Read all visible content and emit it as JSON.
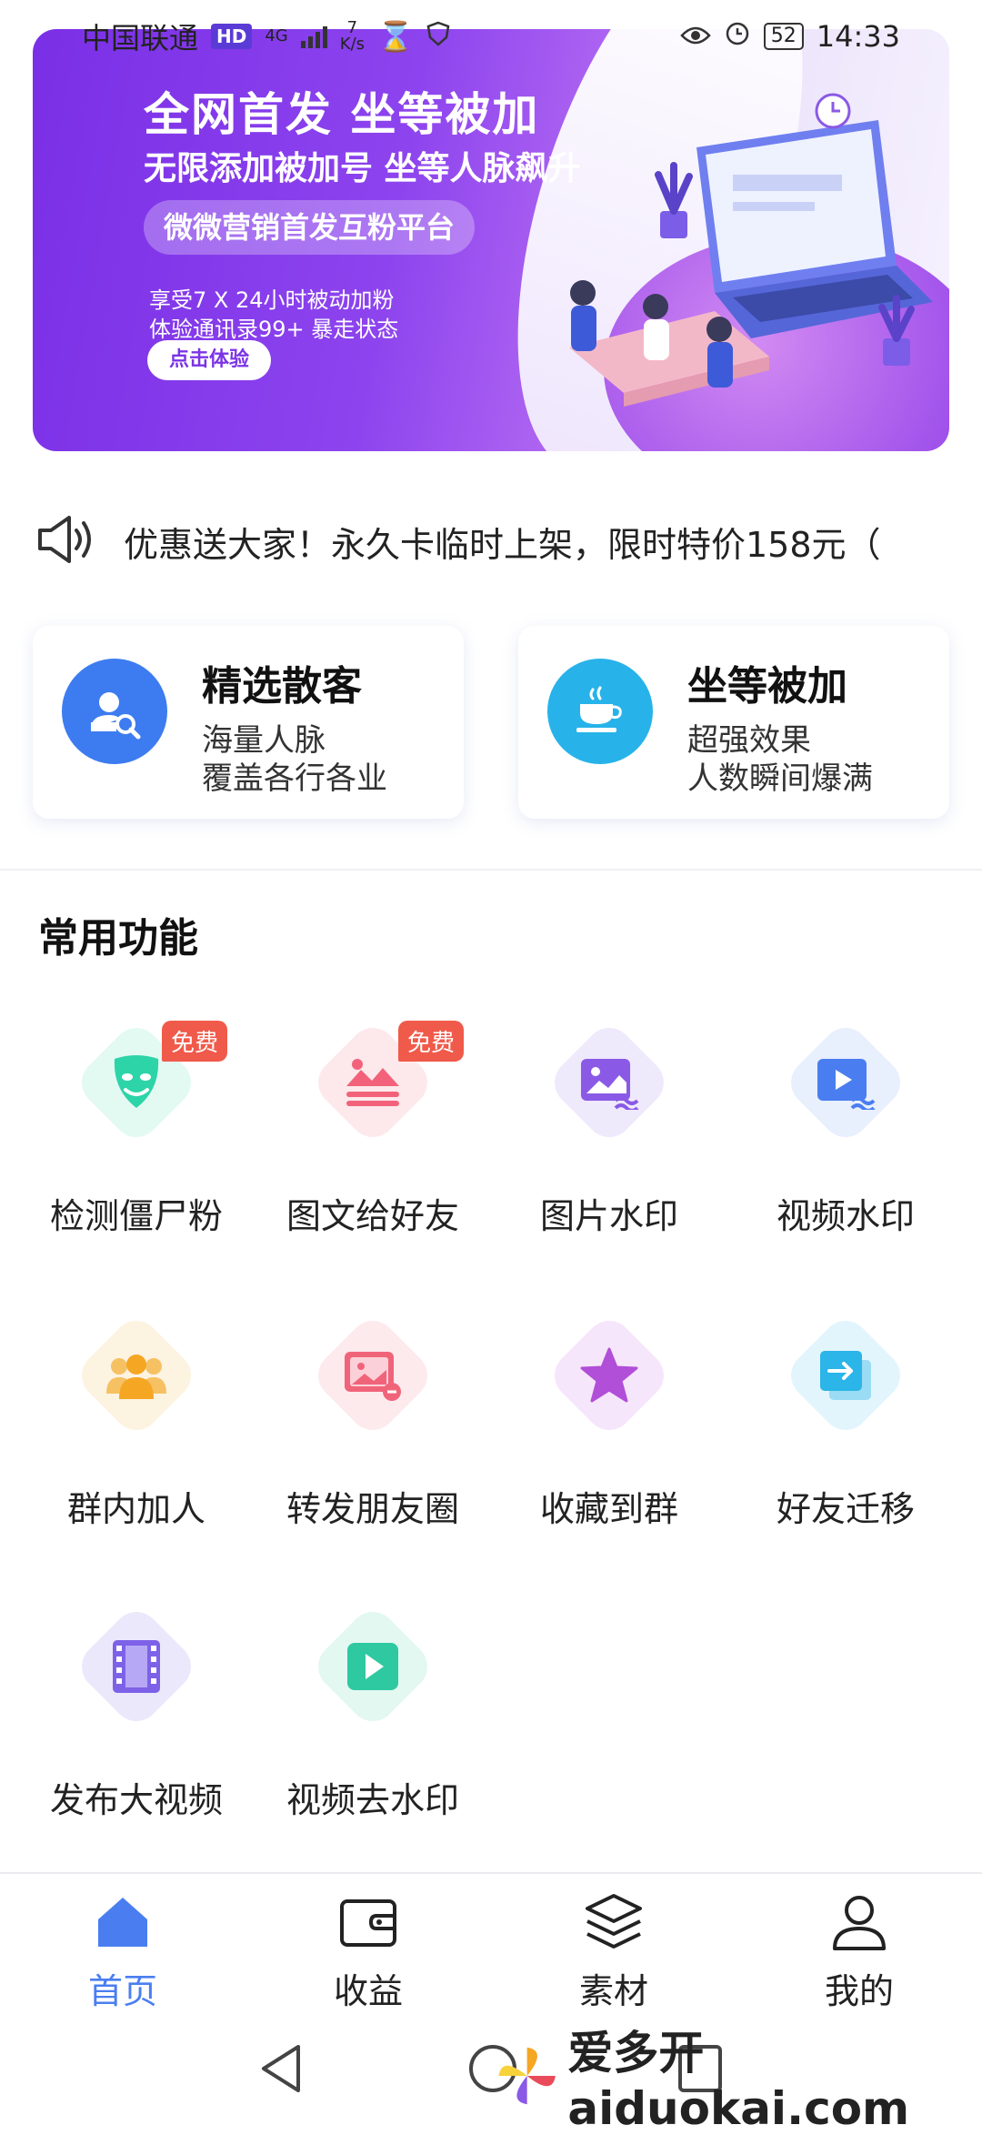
{
  "status_bar": {
    "carrier": "中国联通",
    "hd": "HD",
    "net": "4G",
    "speed_value": "7",
    "speed_unit": "K/s",
    "battery": "52",
    "time": "14:33"
  },
  "banner": {
    "title": "全网首发 坐等被加",
    "subtitle": "无限添加被加号 坐等人脉飙升",
    "pill": "微微营销首发互粉平台",
    "line1": "享受7 X 24小时被动加粉",
    "line2": "体验通讯录99+ 暴走状态",
    "cta": "点击体验"
  },
  "notice": {
    "icon": "megaphone-icon",
    "text": "优惠送大家！永久卡临时上架，限时特价158元（"
  },
  "cards": [
    {
      "title": "精选散客",
      "line1": "海量人脉",
      "line2": "覆盖各行各业",
      "icon": "user-search-icon",
      "color": "#3d7cf0"
    },
    {
      "title": "坐等被加",
      "line1": "超强效果",
      "line2": "人数瞬间爆满",
      "icon": "coffee-cup-icon",
      "color": "#27b3ea"
    }
  ],
  "section": {
    "title": "常用功能"
  },
  "features": [
    {
      "label": "检测僵尸粉",
      "badge": "免费",
      "icon": "mask-icon",
      "color": "#2dd4a8",
      "bg": "#e3faf3"
    },
    {
      "label": "图文给好友",
      "badge": "免费",
      "icon": "image-text-icon",
      "color": "#f2637b",
      "bg": "#fde9ec"
    },
    {
      "label": "图片水印",
      "badge": "",
      "icon": "image-watermark-icon",
      "color": "#8a5ae6",
      "bg": "#efe9fc"
    },
    {
      "label": "视频水印",
      "badge": "",
      "icon": "video-watermark-icon",
      "color": "#4a7ef0",
      "bg": "#e8effd"
    },
    {
      "label": "群内加人",
      "badge": "",
      "icon": "group-users-icon",
      "color": "#f5a623",
      "bg": "#fdf3e1"
    },
    {
      "label": "转发朋友圈",
      "badge": "",
      "icon": "share-moments-icon",
      "color": "#f0647a",
      "bg": "#fdeaed"
    },
    {
      "label": "收藏到群",
      "badge": "",
      "icon": "star-icon",
      "color": "#b14fd8",
      "bg": "#f6e6fb"
    },
    {
      "label": "好友迁移",
      "badge": "",
      "icon": "migrate-icon",
      "color": "#2bb5e8",
      "bg": "#e3f5fc"
    },
    {
      "label": "发布大视频",
      "badge": "",
      "icon": "film-icon",
      "color": "#7d62e8",
      "bg": "#ece8fc"
    },
    {
      "label": "视频去水印",
      "badge": "",
      "icon": "play-icon",
      "color": "#2ec9a0",
      "bg": "#e2f8f1"
    }
  ],
  "bottom_nav": [
    {
      "label": "首页",
      "icon": "home-icon",
      "active": true
    },
    {
      "label": "收益",
      "icon": "wallet-icon",
      "active": false
    },
    {
      "label": "素材",
      "icon": "layers-icon",
      "active": false
    },
    {
      "label": "我的",
      "icon": "user-icon",
      "active": false
    }
  ],
  "colors": {
    "accent": "#4a7ef0",
    "banner": "#8a3fe8"
  },
  "watermark": {
    "text": "爱多开aiduokai.com"
  }
}
